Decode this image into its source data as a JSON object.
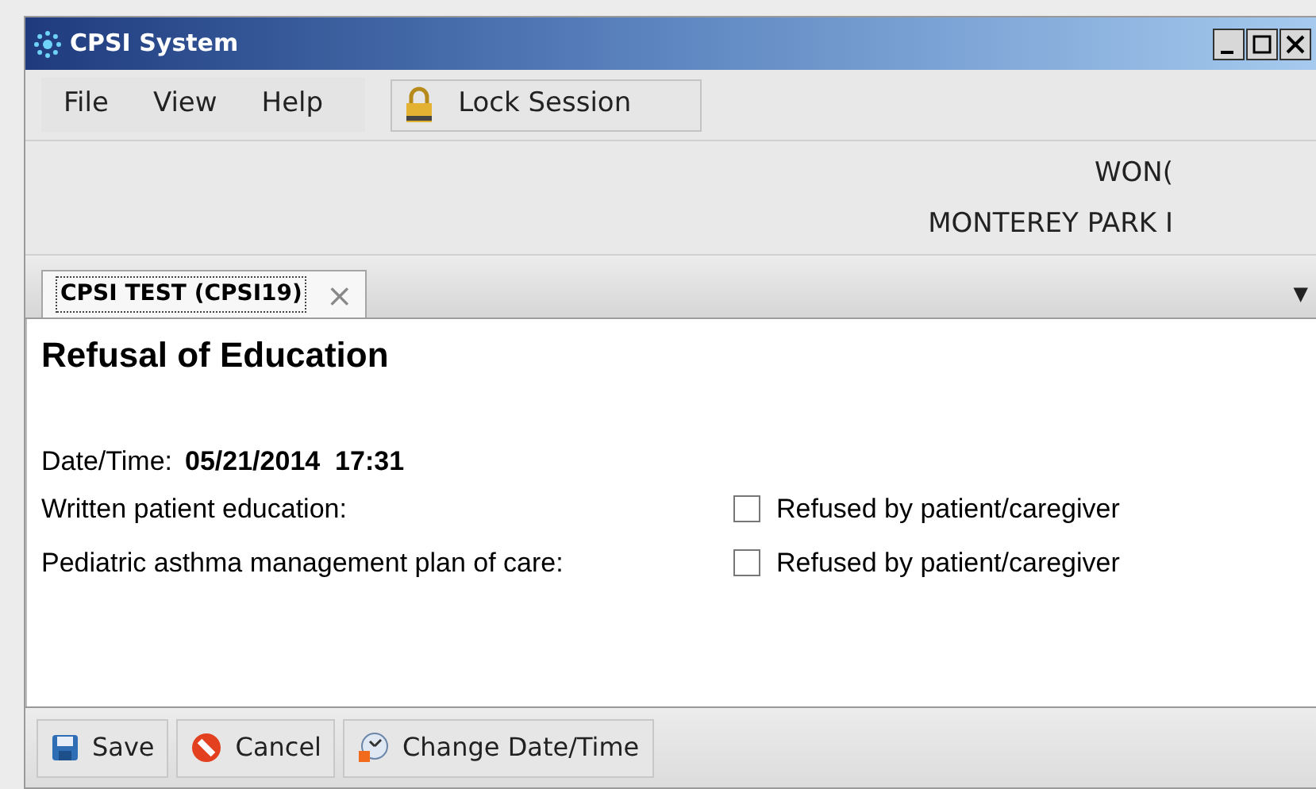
{
  "window": {
    "title": "CPSI System"
  },
  "menu": [
    "File",
    "View",
    "Help"
  ],
  "lock_button": "Lock Session",
  "header": {
    "line_1": "WON(",
    "line_2": "MONTEREY PARK I"
  },
  "tabs": [
    {
      "label": "CPSI TEST (CPSI19)",
      "selected": true,
      "close": "×"
    }
  ],
  "tab_menu": "▼",
  "form": {
    "title": "Refusal of Education",
    "datetime_label": "Date/Time:",
    "datetime_value": "05/21/2014  17:31",
    "rows": [
      {
        "label": "Written patient education:",
        "option": "Refused by patient/caregiver",
        "checked": false
      },
      {
        "label": "Pediatric asthma management plan of care:",
        "option": "Refused by patient/caregiver",
        "checked": false
      }
    ]
  },
  "buttons": [
    {
      "kind": "save",
      "label": "Save"
    },
    {
      "kind": "cancel",
      "label": "Cancel"
    },
    {
      "kind": "datetime",
      "label": "Change Date/Time"
    }
  ]
}
